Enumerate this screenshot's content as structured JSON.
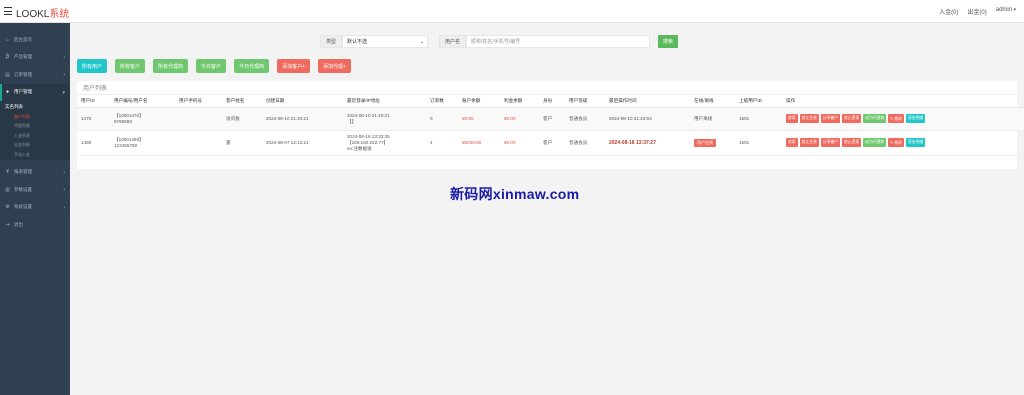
{
  "header": {
    "brand_main": "LOOKL",
    "brand_accent": "系统",
    "deposit": "入金(0)",
    "withdraw": "出金(0)",
    "user": "admin"
  },
  "sidebar": {
    "items": [
      {
        "label": "后台首页",
        "icon": "dashboard-icon"
      },
      {
        "label": "产品管理",
        "icon": "bitcoin-icon"
      },
      {
        "label": "订单管理",
        "icon": "clipboard-icon"
      },
      {
        "label": "用户管理",
        "icon": "user-icon"
      },
      {
        "label": "报表管理",
        "icon": "yen-icon"
      },
      {
        "label": "参数设置",
        "icon": "document-icon"
      },
      {
        "label": "系统设置",
        "icon": "gear-icon"
      },
      {
        "label": "退出",
        "icon": "logout-icon"
      }
    ],
    "submenu": {
      "title": "实名列表",
      "items": [
        "客户列表",
        "代理列表",
        "入金列表",
        "出金列表",
        "手动入金"
      ]
    }
  },
  "search": {
    "type_label": "类型",
    "type_value": "默认不选",
    "username_label": "用户名",
    "placeholder": "昵称/姓名/手机号/编号",
    "button": "搜索"
  },
  "filters": {
    "all_users": "所有用户",
    "all_clients": "所有客户",
    "all_agents": "所有代理商",
    "today_clients": "今日客户",
    "today_agents": "今日代理商",
    "add_client": "添加客户+",
    "add_agent": "添加代理+"
  },
  "table": {
    "title": "用户列表",
    "columns": [
      "用户ID",
      "用户编号/用户名",
      "用户手机号",
      "客户姓名",
      "创建日期",
      "最近登录/IP地址",
      "订单数",
      "账户余额",
      "利金余额",
      "身份",
      "用户等级",
      "最后操作时间",
      "在线/离线",
      "上级用户ID",
      "操作"
    ],
    "rows": [
      {
        "id": "1470",
        "number": "【10001470】",
        "username": "6766588",
        "phone": "",
        "name": "访问板",
        "created": "2024-08-10 21:40:21",
        "login_time": "2024-08-10 21:40:21",
        "login_ip": "【】",
        "login_extra": "",
        "orders": "0",
        "balance": "¥0.00",
        "interest": "¥0.00",
        "identity": "客户",
        "level": "普通会员",
        "last_op": "2024-08-10 21:43:53",
        "online": "用户离线",
        "parent": "1591"
      },
      {
        "id": "1469",
        "number": "【10001469】",
        "username": "123456789",
        "phone": "",
        "name": "嘉",
        "created": "2024-08-07 12:12:21",
        "login_time": "2024-08-18 13:33:35",
        "login_ip": "【169.150.222.77】",
        "login_extra": "en:注数据很",
        "orders": "4",
        "balance": "¥8040.00",
        "interest": "¥0.00",
        "identity": "客户",
        "level": "普通会员",
        "last_op": "2024-08-18 13:37:27",
        "online": "用户在线",
        "parent": "1591"
      }
    ],
    "actions": [
      "禁用",
      "禁止交易",
      "分享撤户",
      "禁止提现",
      "成为代理商",
      "修改",
      "资金明细"
    ]
  },
  "watermark": "新码网xinmaw.com",
  "colors": {
    "sidebar_bg": "#2f4050",
    "teal": "#23c6c8",
    "green": "#6fc76f",
    "red": "#ef6b5f",
    "brand_accent": "#e84c3d"
  }
}
